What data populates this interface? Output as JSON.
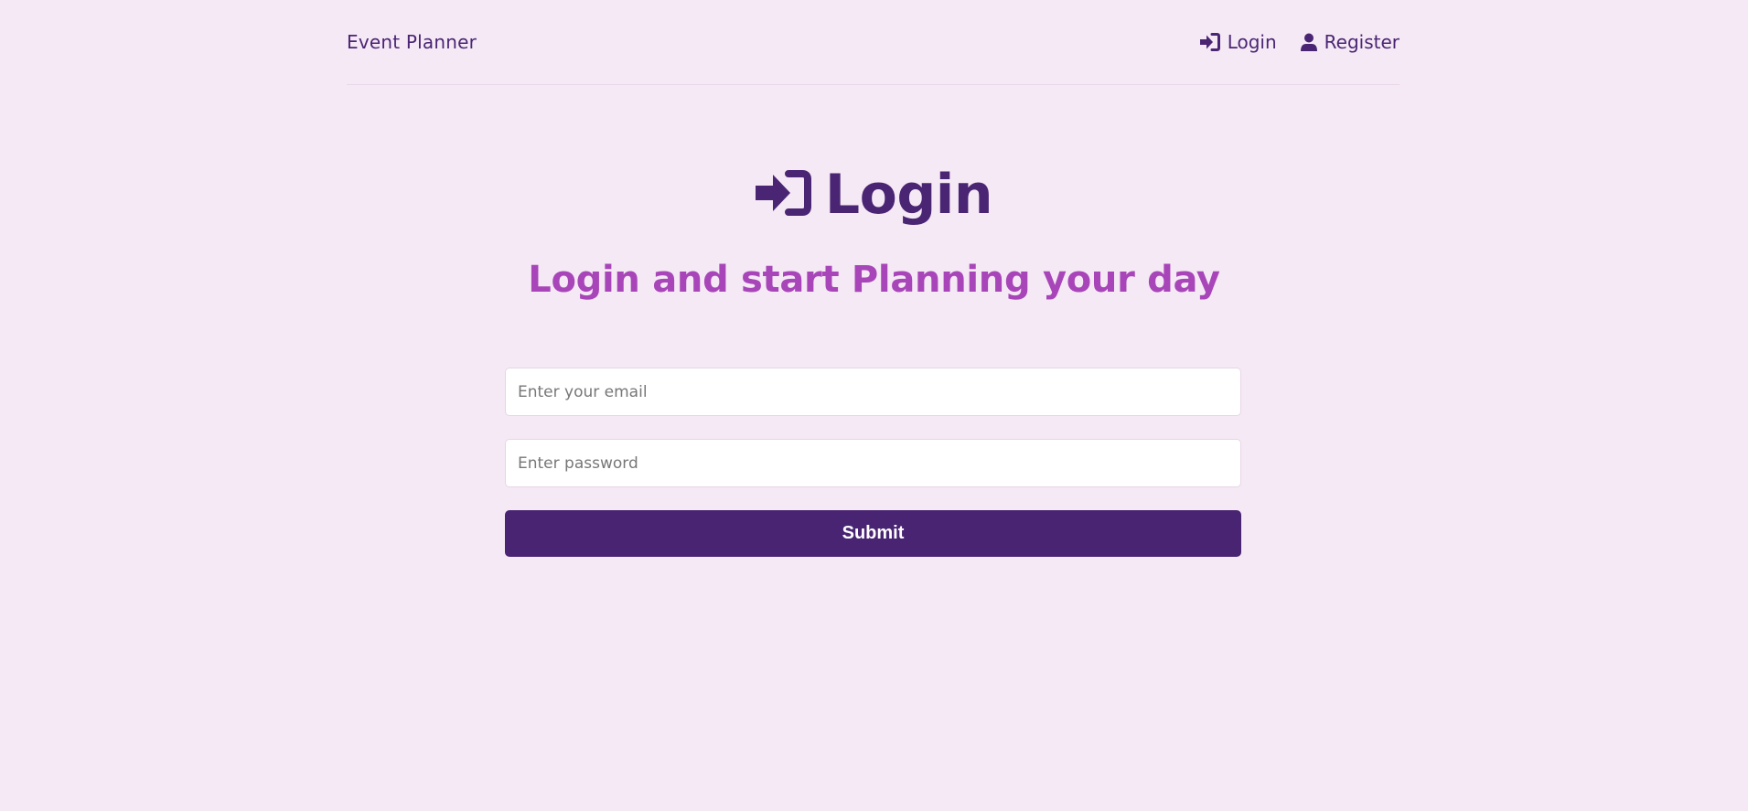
{
  "header": {
    "brand": "Event Planner",
    "nav": [
      {
        "label": "Login",
        "icon": "sign-in-icon"
      },
      {
        "label": "Register",
        "icon": "user-icon"
      }
    ]
  },
  "main": {
    "title": "Login",
    "title_icon": "sign-in-icon",
    "subtitle": "Login and start Planning your day"
  },
  "form": {
    "email": {
      "placeholder": "Enter your email",
      "value": ""
    },
    "password": {
      "placeholder": "Enter password",
      "value": ""
    },
    "submit_label": "Submit"
  },
  "colors": {
    "background": "#f5e9f5",
    "primary": "#4a2574",
    "accent": "#a846b9",
    "button": "#482472"
  }
}
